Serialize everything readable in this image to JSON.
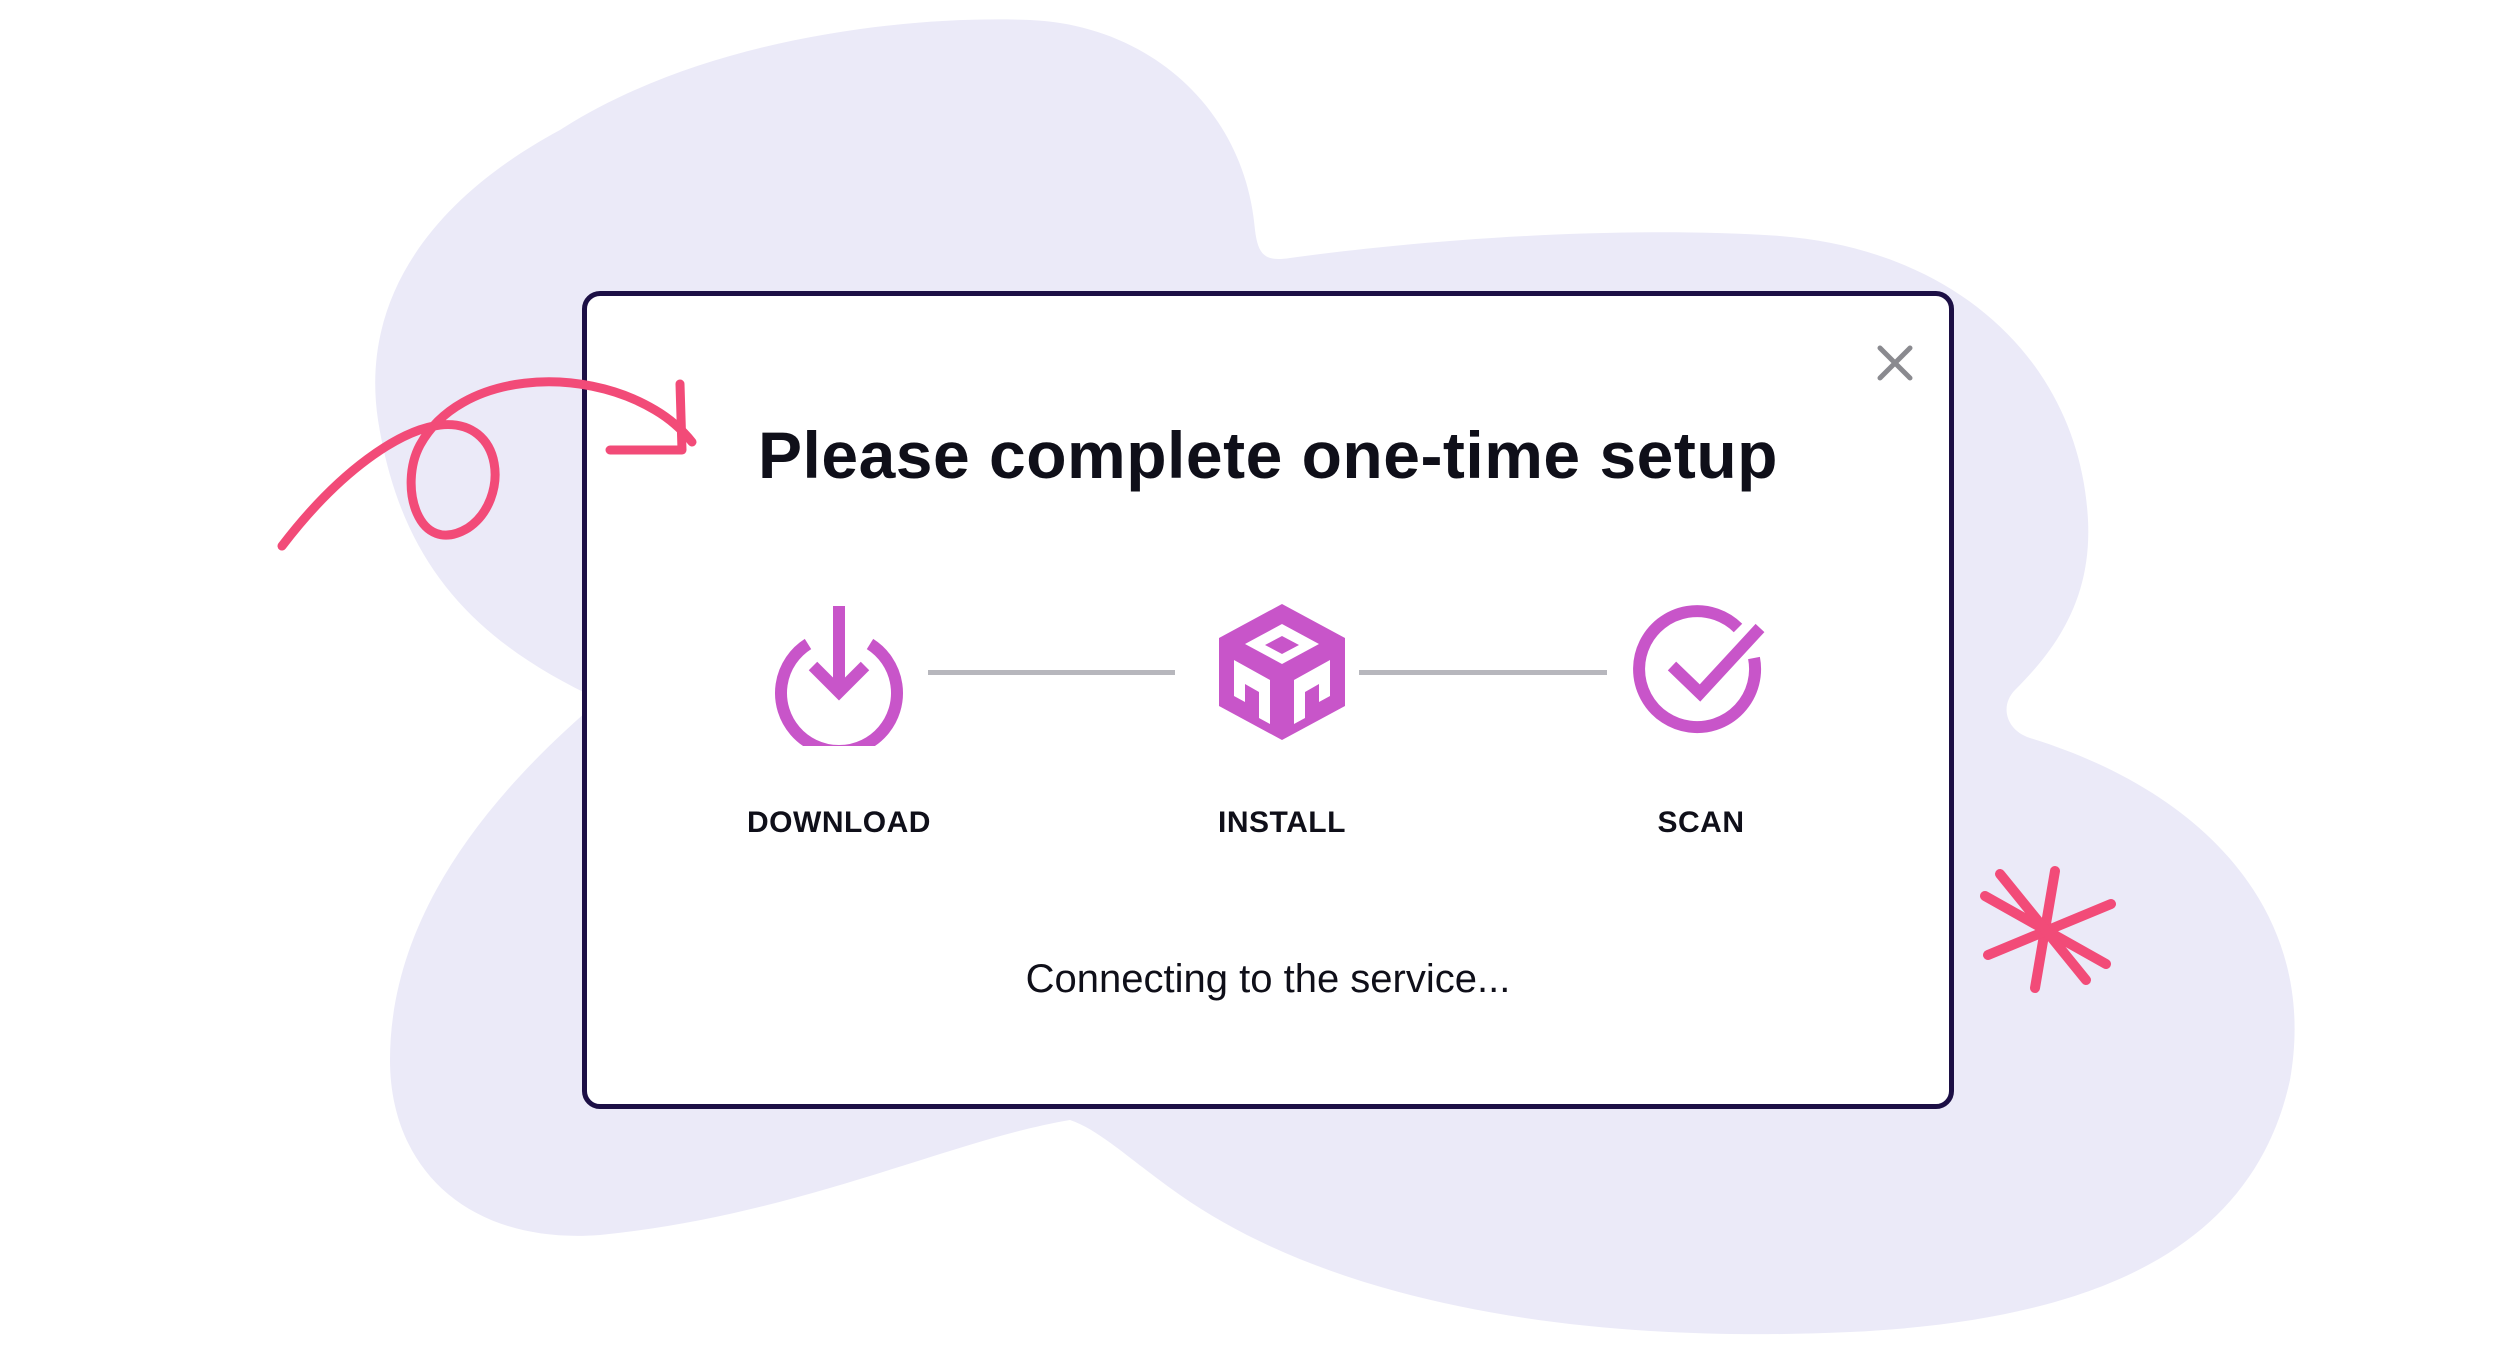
{
  "dialog": {
    "title": "Please complete one-time setup",
    "close_icon": "close-icon",
    "steps": [
      {
        "label": "DOWNLOAD",
        "icon": "download-icon"
      },
      {
        "label": "INSTALL",
        "icon": "package-icon"
      },
      {
        "label": "SCAN",
        "icon": "check-circle-icon"
      }
    ],
    "status_text": "Connecting to the service..."
  },
  "colors": {
    "accent": "#c855c9",
    "border": "#1c0f45",
    "connector": "#b7b7bd",
    "background_blob": "#ebeaf8",
    "decoration": "#f24b78",
    "text": "#0f0f19"
  }
}
